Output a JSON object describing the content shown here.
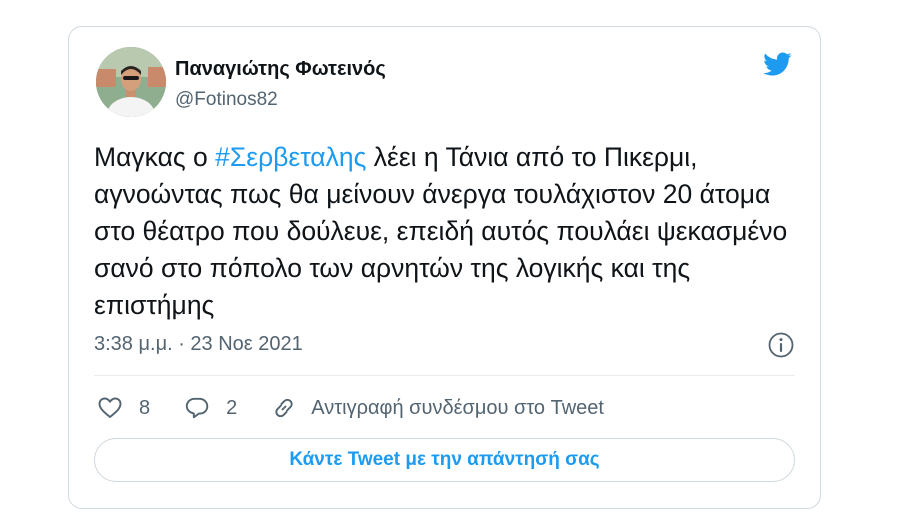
{
  "colors": {
    "accent": "#1d9bf0",
    "secondary_text": "#536471",
    "border": "#cfd9de"
  },
  "author": {
    "display_name": "Παναγιώτης Φωτεινός",
    "handle": "@Fotinos82"
  },
  "tweet": {
    "text_before": "Μαγκας ο ",
    "hashtag": "#Σερβεταλης",
    "text_after": " λέει η Τάνια από το Πικερμι, αγνοώντας πως θα μείνουν άνεργα τουλάχιστον 20 άτομα στο θέατρο που δούλευε, επειδή αυτός πουλάει ψεκασμένο σανό στο πόπολο των αρνητών της λογικής και της επιστήμης",
    "time": "3:38 μ.μ. · 23 Νοε 2021"
  },
  "actions": {
    "like_count": "8",
    "reply_count": "2",
    "copy_link_label": "Αντιγραφή συνδέσμου στο Tweet"
  },
  "reply_button_label": "Κάντε Tweet με την απάντησή σας",
  "icons": [
    "twitter-bird-icon",
    "info-icon",
    "heart-icon",
    "reply-bubble-icon",
    "link-icon"
  ]
}
